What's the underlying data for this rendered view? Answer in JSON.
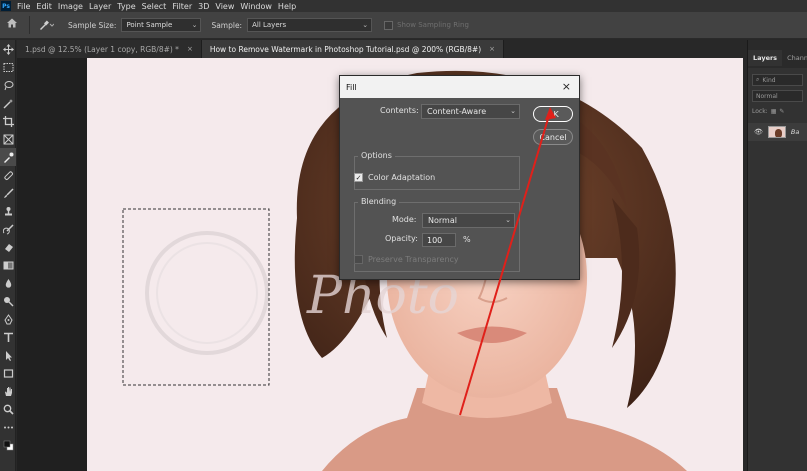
{
  "app": {
    "logo": "Ps"
  },
  "menu": [
    "File",
    "Edit",
    "Image",
    "Layer",
    "Type",
    "Select",
    "Filter",
    "3D",
    "View",
    "Window",
    "Help"
  ],
  "options": {
    "sample_size_label": "Sample Size:",
    "sample_size_value": "Point Sample",
    "sample_label": "Sample:",
    "sample_value": "All Layers",
    "show_ring_label": "Show Sampling Ring"
  },
  "tabs": [
    {
      "label": "1.psd @ 12.5% (Layer 1 copy, RGB/8#) *",
      "close": "×"
    },
    {
      "label": "How to Remove Watermark in Photoshop Tutorial.psd @ 200% (RGB/8#)",
      "close": "×"
    }
  ],
  "panel": {
    "tabs": [
      "Layers",
      "Channels"
    ],
    "kind_placeholder": "Kind",
    "blend_mode": "Normal",
    "lock_label": "Lock:",
    "layer_name": "Ba"
  },
  "dialog": {
    "title": "Fill",
    "close": "×",
    "contents_label": "Contents:",
    "contents_value": "Content-Aware",
    "ok_label": "OK",
    "cancel_label": "Cancel",
    "options_group": "Options",
    "color_adaptation_label": "Color Adaptation",
    "color_adaptation_checked": true,
    "blending_group": "Blending",
    "mode_label": "Mode:",
    "mode_value": "Normal",
    "opacity_label": "Opacity:",
    "opacity_value": "100",
    "opacity_unit": "%",
    "preserve_label": "Preserve Transparency",
    "checkmark": "✓"
  },
  "colors": {
    "annotation_arrow": "#e0201a",
    "skin": "#f3c8b6",
    "hair": "#5a3322",
    "sweater": "#d99a86",
    "background": "#f5eaec"
  }
}
